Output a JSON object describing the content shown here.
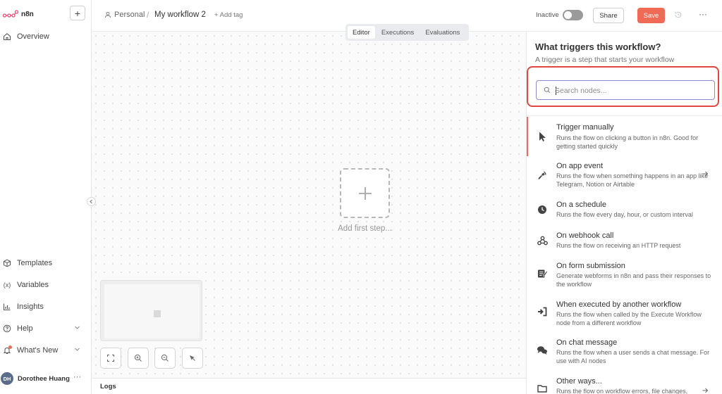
{
  "app": {
    "brand": "n8n"
  },
  "sidebar": {
    "new_button": "+",
    "items": [
      {
        "id": "overview",
        "label": "Overview",
        "icon": "home-icon"
      },
      {
        "id": "templates",
        "label": "Templates",
        "icon": "box-icon"
      },
      {
        "id": "variables",
        "label": "Variables",
        "icon": "variables-icon"
      },
      {
        "id": "insights",
        "label": "Insights",
        "icon": "bar-chart-icon"
      },
      {
        "id": "help",
        "label": "Help",
        "icon": "help-icon"
      },
      {
        "id": "whats-new",
        "label": "What's New",
        "icon": "bell-icon"
      }
    ],
    "user": {
      "initials": "DH",
      "name": "Dorothee Huang",
      "more": "···"
    }
  },
  "header": {
    "project": "Personal",
    "separator": "/",
    "workflow_name": "My workflow 2",
    "add_tag": "+ Add tag",
    "active_label": "Inactive",
    "active": false,
    "share_label": "Share",
    "save_label": "Save",
    "more": "···"
  },
  "tabs": [
    {
      "label": "Editor",
      "active": true
    },
    {
      "label": "Executions",
      "active": false
    },
    {
      "label": "Evaluations",
      "active": false
    }
  ],
  "canvas": {
    "add_first_step": "Add first step...",
    "logs_label": "Logs"
  },
  "panel": {
    "title": "What triggers this workflow?",
    "subtitle": "A trigger is a step that starts your workflow",
    "search_placeholder": "Search nodes...",
    "search_value": "",
    "triggers": [
      {
        "title": "Trigger manually",
        "desc": "Runs the flow on clicking a button in n8n. Good for getting started quickly",
        "icon": "cursor-icon"
      },
      {
        "title": "On app event",
        "desc": "Runs the flow when something happens in an app like Telegram, Notion or Airtable",
        "icon": "app-event-icon"
      },
      {
        "title": "On a schedule",
        "desc": "Runs the flow every day, hour, or custom interval",
        "icon": "clock-icon"
      },
      {
        "title": "On webhook call",
        "desc": "Runs the flow on receiving an HTTP request",
        "icon": "webhook-icon"
      },
      {
        "title": "On form submission",
        "desc": "Generate webforms in n8n and pass their responses to the workflow",
        "icon": "form-icon"
      },
      {
        "title": "When executed by another workflow",
        "desc": "Runs the flow when called by the Execute Workflow node from a different workflow",
        "icon": "sign-in-icon"
      },
      {
        "title": "On chat message",
        "desc": "Runs the flow when a user sends a chat message. For use with AI nodes",
        "icon": "chat-icon"
      },
      {
        "title": "Other ways...",
        "desc": "Runs the flow on workflow errors, file changes,",
        "icon": "folder-icon"
      }
    ]
  },
  "colors": {
    "accent": "#ef6b56",
    "highlight": "#e0483d",
    "search_border": "#8c8bd6"
  }
}
